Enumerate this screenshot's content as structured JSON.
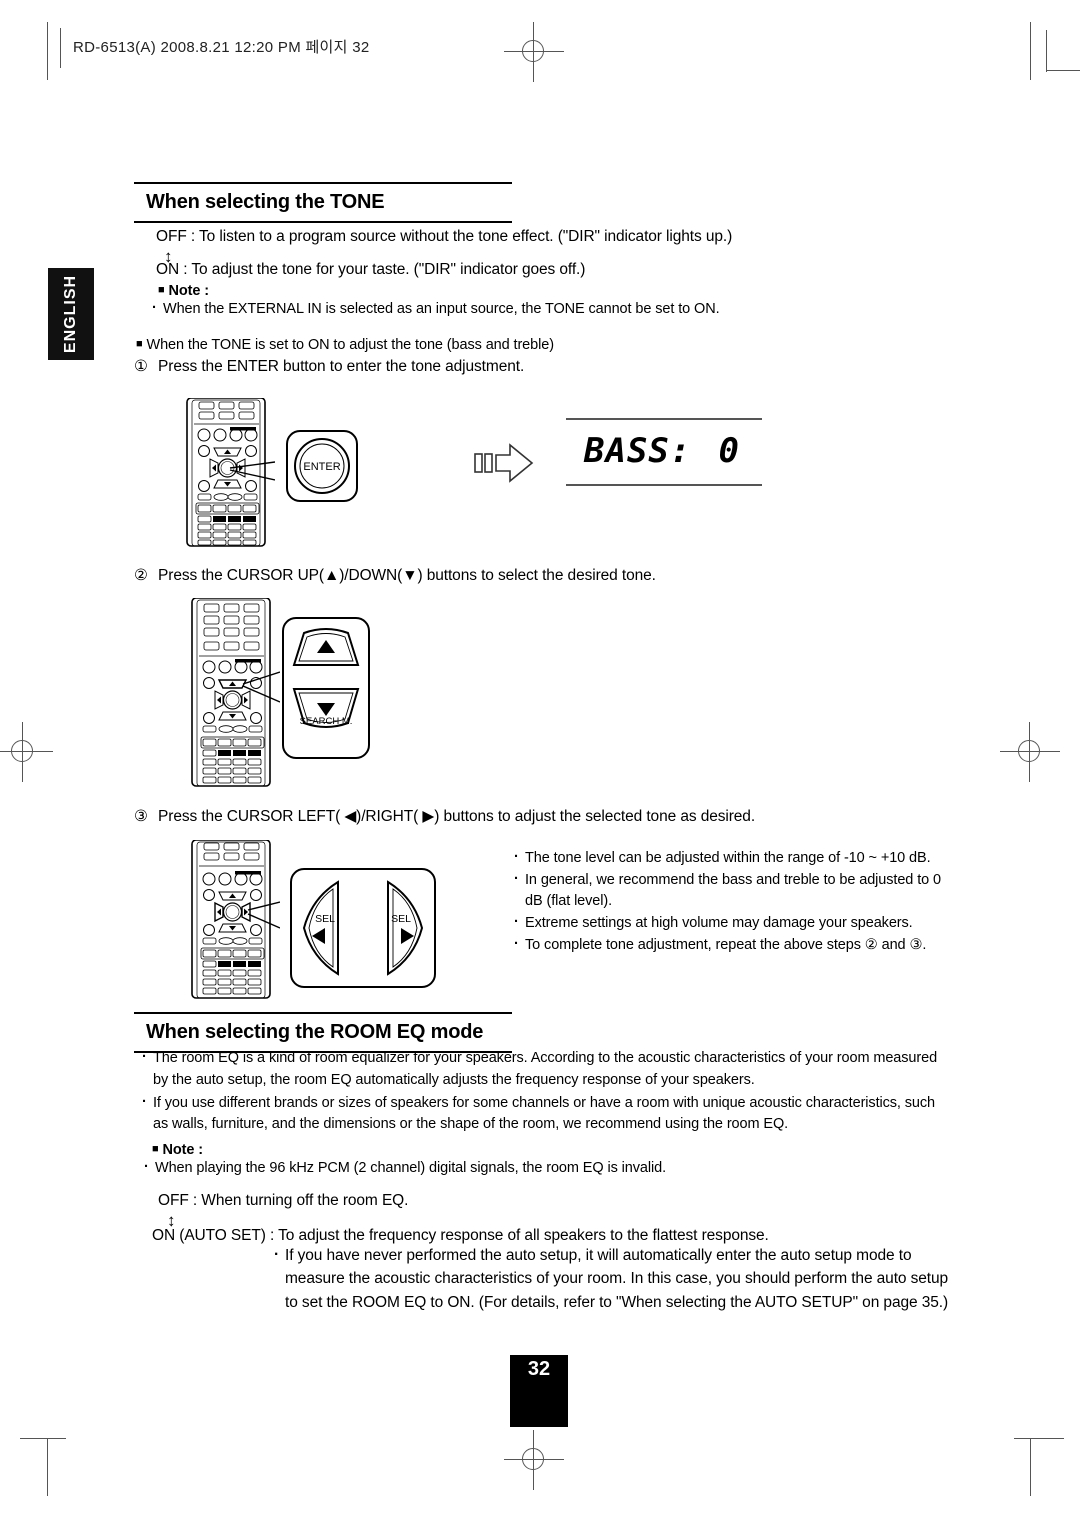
{
  "print_header": "RD-6513(A)  2008.8.21  12:20 PM  페이지 32",
  "language_tab": "ENGLISH",
  "page_number": "32",
  "section_tone": {
    "title": "When selecting the TONE",
    "off_line": "OFF : To listen to a program source without the tone effect. (\"DIR\" indicator lights up.)",
    "toggle_glyph": "↕",
    "on_line": "ON : To adjust the tone for your taste. (\"DIR\" indicator goes off.)",
    "note_label": "Note :",
    "note_item": "When the EXTERNAL IN is selected as an input source, the TONE cannot be set to ON.",
    "subhead": "When the TONE is set to ON to adjust the tone (bass and treble)",
    "step1": "Press the ENTER button to enter the tone adjustment.",
    "step1_num": "①",
    "step2": "Press the CURSOR UP(▲)/DOWN(▼) buttons to select the desired tone.",
    "step2_num": "②",
    "step3": "Press the CURSOR LEFT( ◀)/RIGHT( ▶) buttons to adjust the selected tone as desired.",
    "step3_num": "③",
    "tips": [
      "The tone level can be adjusted within the range of  -10 ~ +10 dB.",
      "In general, we recommend the bass and treble to be adjusted to 0 dB (flat level).",
      "Extreme settings at high volume may damage your speakers.",
      "To complete tone adjustment, repeat the above steps ② and ③."
    ]
  },
  "display": {
    "label": "BASS:",
    "value": "0"
  },
  "callouts": {
    "enter": "ENTER",
    "up_arrow": "▲",
    "down_arrow": "▼",
    "search_label": "SEARCH M.",
    "sel_left_label": "SEL",
    "sel_left_arrow": "◀",
    "sel_right_label": "SEL",
    "sel_right_arrow": "▶"
  },
  "section_roomeq": {
    "title": "When selecting the ROOM EQ mode",
    "bullets": [
      "The room EQ is a kind of room equalizer for your speakers. According to the acoustic characteristics of your room measured by the auto setup, the room EQ automatically adjusts the frequency response of your speakers.",
      "If you use different brands or sizes of speakers for some channels or have a room with unique acoustic characteristics, such as walls, furniture, and the dimensions or the shape of the room, we recommend using the room EQ."
    ],
    "note_label": "Note :",
    "note_item": "When playing the 96 kHz PCM (2 channel) digital signals, the room EQ is invalid.",
    "off_line": "OFF : When turning off the room EQ.",
    "toggle_glyph": "↕",
    "on_line": "ON (AUTO SET) : To adjust the frequency response of all speakers to the flattest response.",
    "on_detail": "If you have never performed the auto setup, it will automatically enter the auto setup mode to measure the acoustic characteristics of your room. In this case, you should perform the auto setup to set the ROOM EQ to ON. (For details, refer to \"When selecting the AUTO SETUP\" on page 35.)"
  }
}
